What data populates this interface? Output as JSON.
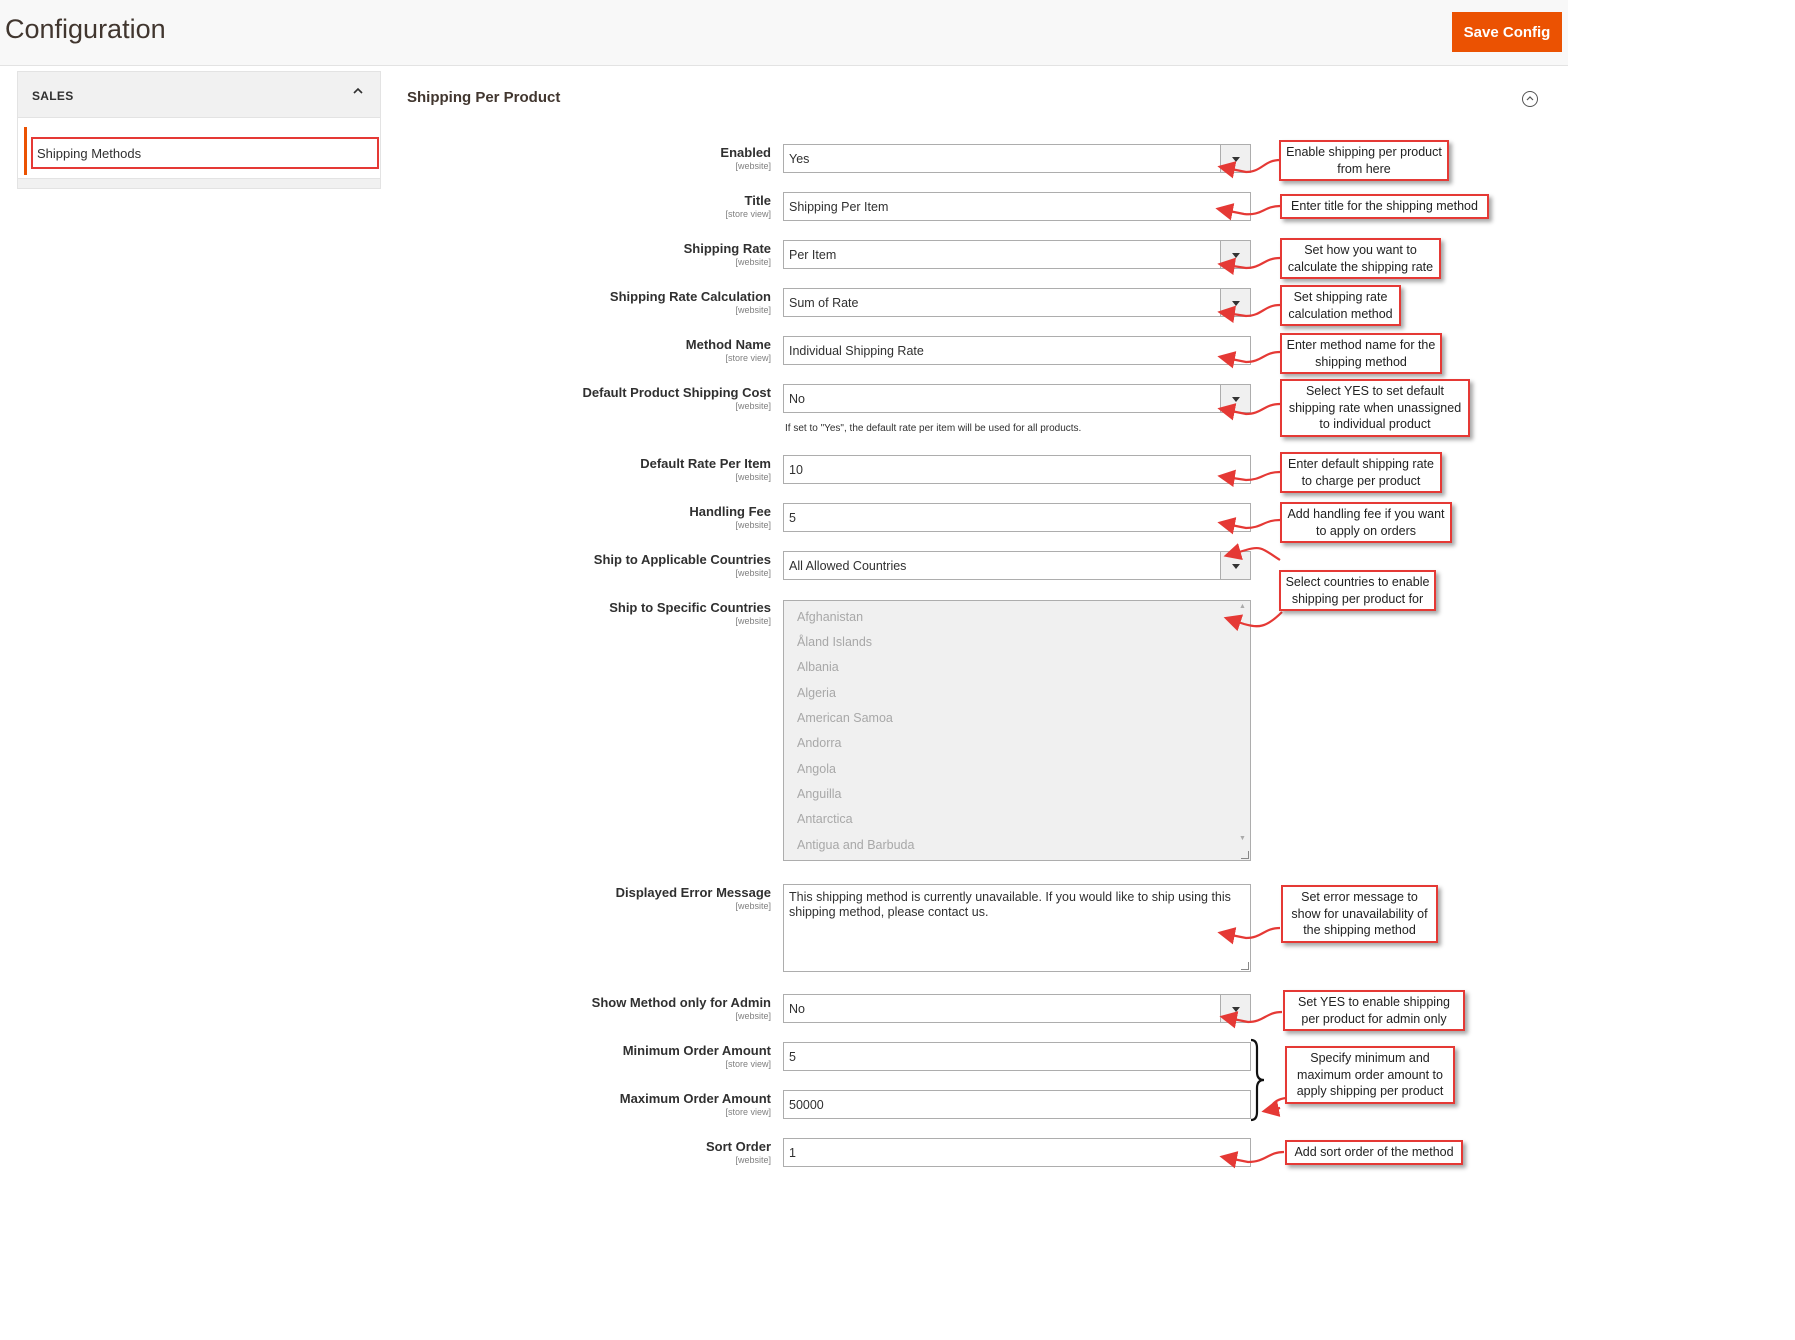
{
  "header": {
    "title": "Configuration",
    "save_label": "Save Config"
  },
  "sidebar": {
    "section": "SALES",
    "item": "Shipping Methods"
  },
  "section": {
    "title": "Shipping Per Product"
  },
  "fields": [
    {
      "label": "Enabled",
      "scope": "[website]",
      "value": "Yes"
    },
    {
      "label": "Title",
      "scope": "[store view]",
      "value": "Shipping Per Item"
    },
    {
      "label": "Shipping Rate",
      "scope": "[website]",
      "value": "Per Item"
    },
    {
      "label": "Shipping Rate Calculation",
      "scope": "[website]",
      "value": "Sum of Rate"
    },
    {
      "label": "Method Name",
      "scope": "[store view]",
      "value": "Individual Shipping Rate"
    },
    {
      "label": "Default Product Shipping Cost",
      "scope": "[website]",
      "value": "No",
      "note": "If set to \"Yes\", the default rate per item will be used for all products."
    },
    {
      "label": "Default Rate Per Item",
      "scope": "[website]",
      "value": "10"
    },
    {
      "label": "Handling Fee",
      "scope": "[website]",
      "value": "5"
    },
    {
      "label": "Ship to Applicable Countries",
      "scope": "[website]",
      "value": "All Allowed Countries"
    },
    {
      "label": "Ship to Specific Countries",
      "scope": "[website]",
      "options": [
        "Afghanistan",
        "Åland Islands",
        "Albania",
        "Algeria",
        "American Samoa",
        "Andorra",
        "Angola",
        "Anguilla",
        "Antarctica",
        "Antigua and Barbuda"
      ]
    },
    {
      "label": "Displayed Error Message",
      "scope": "[website]",
      "value": "This shipping method is currently unavailable. If you would like to ship using this shipping method, please contact us."
    },
    {
      "label": "Show Method only for Admin",
      "scope": "[website]",
      "value": "No"
    },
    {
      "label": "Minimum Order Amount",
      "scope": "[store view]",
      "value": "5"
    },
    {
      "label": "Maximum Order Amount",
      "scope": "[store view]",
      "value": "50000"
    },
    {
      "label": "Sort Order",
      "scope": "[website]",
      "value": "1"
    }
  ],
  "callouts": [
    "Enable shipping per product from here",
    "Enter title for the shipping method",
    "Set how you want to calculate the shipping rate",
    "Set shipping rate calculation method",
    "Enter method name for the shipping method",
    "Select YES to set default shipping rate when unassigned to individual product",
    "Enter default shipping rate to charge per product",
    "Add handling fee if you want to apply on orders",
    "Select countries to enable shipping per product for",
    "Set error message to show for unavailability of the shipping method",
    "Set YES to enable shipping per product for admin only",
    "Specify minimum and maximum order amount to apply shipping per product",
    "Add sort order of the method"
  ],
  "colors": {
    "accent": "#eb5202",
    "callout_border": "#e53935"
  }
}
